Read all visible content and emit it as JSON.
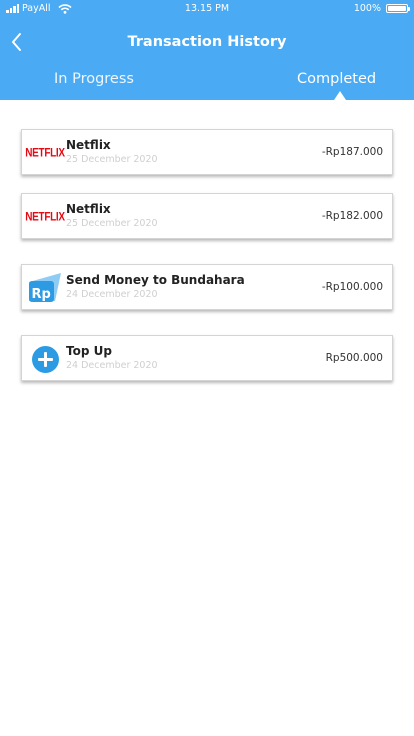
{
  "status_bar": {
    "carrier": "PayAll",
    "time": "13.15 PM",
    "battery": "100%",
    "battery_level": 1.0,
    "icons": [
      "signal-icon",
      "wifi-icon",
      "battery-icon"
    ]
  },
  "header": {
    "title": "Transaction History",
    "back_icon": "chevron-left-icon",
    "background_color": "#4aaaf3"
  },
  "tabs": [
    {
      "label": "In Progress",
      "active": false
    },
    {
      "label": "Completed",
      "active": true
    }
  ],
  "transactions": [
    {
      "logo": "NETFLIX",
      "logo_icon": "netflix-logo",
      "name": "Netflix",
      "date": "25 December 2020",
      "amount": "-Rp187.000"
    },
    {
      "logo": "NETFLIX",
      "logo_icon": "netflix-logo",
      "name": "Netflix",
      "date": "25 December 2020",
      "amount": "-Rp182.000"
    },
    {
      "logo": "Rp",
      "logo_icon": "send-money-icon",
      "name": "Send Money to Bundahara",
      "date": "24 December 2020",
      "amount": "-Rp100.000"
    },
    {
      "logo_icon": "plus-circle-icon",
      "name": "Top Up",
      "date": "24 December 2020",
      "amount": "Rp500.000"
    }
  ]
}
